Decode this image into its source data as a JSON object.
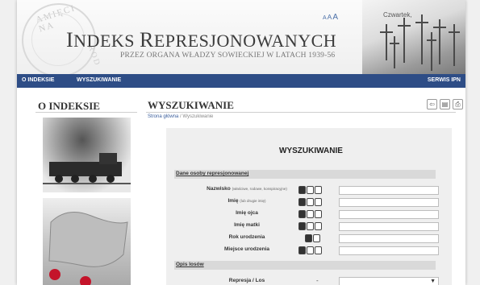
{
  "header": {
    "seal_text_top": "AMIĘCI NA",
    "seal_text_right": "ROD",
    "title_prefix_cap": "I",
    "title_prefix": "NDEKS ",
    "title_suffix_cap": "R",
    "title_suffix": "EPRESJONOWANYCH",
    "subtitle": "PRZEZ ORGANA WŁADZY SOWIECKIEJ W LATACH 1939-56",
    "font_sizes": [
      "A",
      "A",
      "A"
    ],
    "date": "Czwartek,"
  },
  "nav": {
    "items": [
      "O INDEKSIE",
      "WYSZUKIWANIE"
    ],
    "right": "SERWIS IPN"
  },
  "sidebar": {
    "title": "O INDEKSIE"
  },
  "main": {
    "title": "WYSZUKIWANIE",
    "breadcrumb_home": "Strona główna",
    "breadcrumb_current": "Wyszukiwanie",
    "tools": [
      "back-icon",
      "pdf-icon",
      "print-icon"
    ]
  },
  "form": {
    "title": "WYSZUKIWANIE",
    "section1": "Dane osoby represjonowanej",
    "rows": [
      {
        "label": "Nazwisko",
        "hint": "(właściwe, rodowe, konspiracyjne)",
        "options": 3
      },
      {
        "label": "Imię",
        "hint": "(lub drugie imię)",
        "options": 3
      },
      {
        "label": "Imię ojca",
        "hint": "",
        "options": 3
      },
      {
        "label": "Imię matki",
        "hint": "",
        "options": 3
      },
      {
        "label": "Rok urodzenia",
        "hint": "",
        "options": 2
      },
      {
        "label": "Miejsce urodzenia",
        "hint": "",
        "options": 3
      }
    ],
    "section2": "Opis losów",
    "repression_label": "Represja / Los",
    "repression_dash": "-",
    "select_value": ""
  },
  "colors": {
    "nav_bg": "#2e4d86",
    "accent_link": "#3b5e9c",
    "marker": "#c4142a"
  }
}
